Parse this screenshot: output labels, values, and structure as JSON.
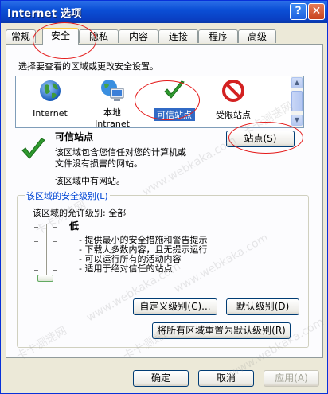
{
  "window": {
    "title": "Internet 选项",
    "help_button": "?",
    "close_button": "✕"
  },
  "tabs": [
    "常规",
    "安全",
    "隐私",
    "内容",
    "连接",
    "程序",
    "高级"
  ],
  "active_tab": "安全",
  "instructions": "选择要查看的区域或更改安全设置。",
  "zones": [
    {
      "label": "Internet"
    },
    {
      "label": "本地",
      "label2": "Intranet"
    },
    {
      "label": "可信站点",
      "selected": true
    },
    {
      "label": "受限站点"
    }
  ],
  "zone_info": {
    "heading": "可信站点",
    "description_line1": "该区域包含您信任对您的计算机或",
    "description_line2": "文件没有损害的网站。",
    "sites_note": "该区域中有网站。",
    "sites_button": "站点(S)"
  },
  "security_level": {
    "group_label": "该区域的安全级别(L)",
    "allowed_levels": "该区域的允许级别: 全部",
    "level_name": "低",
    "bullets": [
      "- 提供最小的安全措施和警告提示",
      "- 下载大多数内容，且无提示运行",
      "- 可以运行所有的活动内容",
      "- 适用于绝对信任的站点"
    ],
    "slider_level": "低",
    "custom_button": "自定义级别(C)...",
    "default_button": "默认级别(D)"
  },
  "reset_all_button": "将所有区域重置为默认级别(R)",
  "footer": {
    "ok": "确定",
    "cancel": "取消",
    "apply": "应用(A)"
  },
  "watermarks": [
    "www.webkaka.com",
    "卡卡测速网",
    "www.webkaka.com",
    "卡卡测速网",
    "www.webkaka.com",
    "卡卡测速网",
    "www.webkaka.com",
    "卡卡测速网"
  ],
  "colors": {
    "titlebar": "#0b4fd6",
    "dialog": "#ece9d8",
    "link_blue": "#0046d5",
    "highlight": "#316ac5",
    "annotation": "#e41a1a"
  }
}
